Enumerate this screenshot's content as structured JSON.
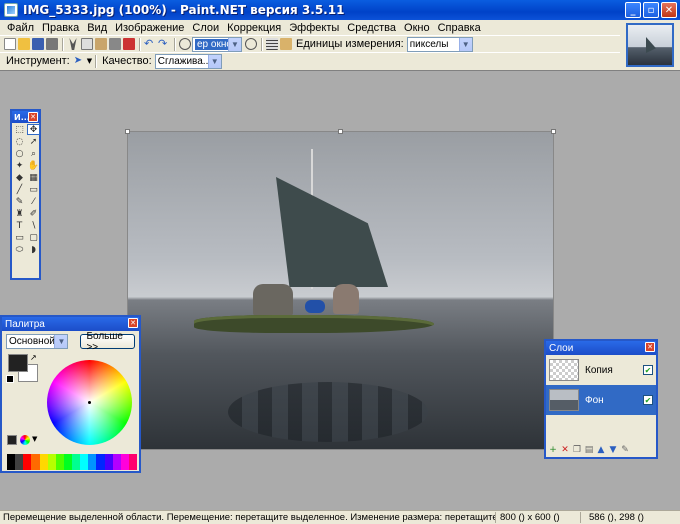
{
  "window": {
    "title": "IMG_5333.jpg (100%) - Paint.NET версия 3.5.11",
    "buttons": [
      "_",
      "▫",
      "✕"
    ]
  },
  "menu": [
    "Файл",
    "Правка",
    "Вид",
    "Изображение",
    "Слои",
    "Коррекция",
    "Эффекты",
    "Средства",
    "Окно",
    "Справка"
  ],
  "toolbar": {
    "zoom_value": "ер окно",
    "units_label": "Единицы измерения:",
    "units_value": "пикселы",
    "tool_label": "Инструмент:",
    "quality_label": "Качество:",
    "quality_value": "Сглажива..."
  },
  "tools_window": {
    "title": "И..."
  },
  "palette": {
    "title": "Палитра",
    "preset": "Основной",
    "more_button": "Больше >>",
    "primary_color": "#222222",
    "secondary_color": "#ffffff",
    "swatches": [
      "#000000",
      "#404040",
      "#ff0000",
      "#ff6a00",
      "#ffd800",
      "#b6ff00",
      "#4cff00",
      "#00ff21",
      "#00ff90",
      "#00ffff",
      "#0094ff",
      "#0026ff",
      "#4800ff",
      "#b200ff",
      "#ff00dc",
      "#ff006e"
    ]
  },
  "layers": {
    "title": "Слои",
    "items": [
      {
        "name": "Копия",
        "selected": false,
        "visible": true
      },
      {
        "name": "Фон",
        "selected": true,
        "visible": true
      }
    ]
  },
  "status": {
    "message": "Перемещение выделенной области. Перемещение: перетащите выделенное. Изменение размера: перетащите марке",
    "size": "800 () x 600 ()",
    "position": "586 (), 298 ()"
  }
}
